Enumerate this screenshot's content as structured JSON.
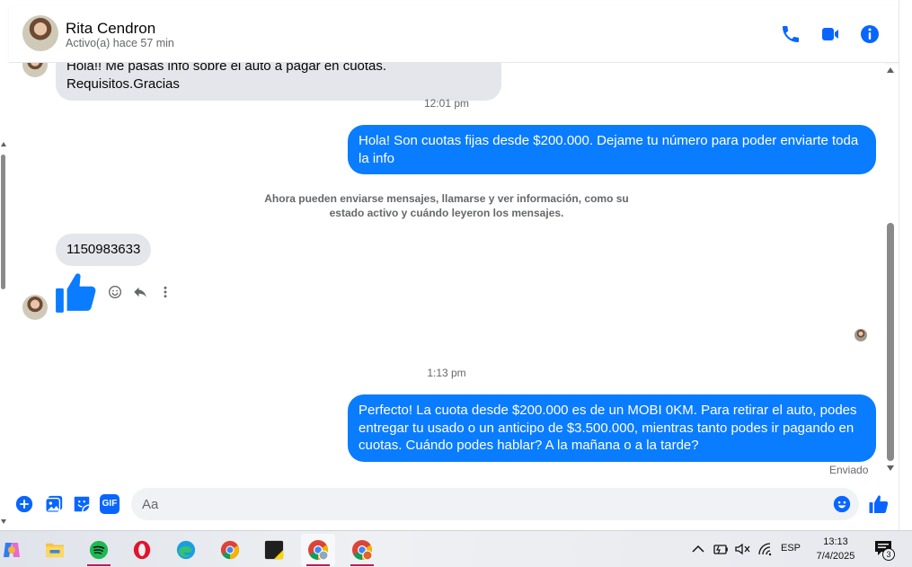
{
  "header": {
    "name": "Rita Cendron",
    "status": "Activo(a) hace 57 min"
  },
  "messages": {
    "m0": "Hola!! Me pasas info sobre el auto a pagar en cuotas. Requisitos.Gracias",
    "t1": "12:01 pm",
    "m1": "Hola! Son cuotas fijas desde $200.000. Dejame tu número para poder enviarte toda la info",
    "notice": "Ahora pueden enviarse mensajes, llamarse y ver información, como su estado activo y cuándo leyeron los mensajes.",
    "m2": "1150983633",
    "t2": "1:13 pm",
    "m3": "Perfecto! La cuota desde $200.000 es de un MOBI 0KM. Para retirar el auto, podes entregar tu usado o un anticipo de $3.500.000, mientras tanto podes ir pagando en cuotas. Cuándo podes hablar? A la mañana o a la tarde?",
    "sent": "Enviado"
  },
  "composer": {
    "placeholder": "Aa",
    "gif_label": "GIF"
  },
  "taskbar": {
    "language": "ESP",
    "time": "13:13",
    "date": "7/4/2025",
    "notifications": "3"
  },
  "colors": {
    "accent": "#0a7cff",
    "incoming_bubble": "#e4e6eb",
    "icon_blue": "#0866ff"
  }
}
